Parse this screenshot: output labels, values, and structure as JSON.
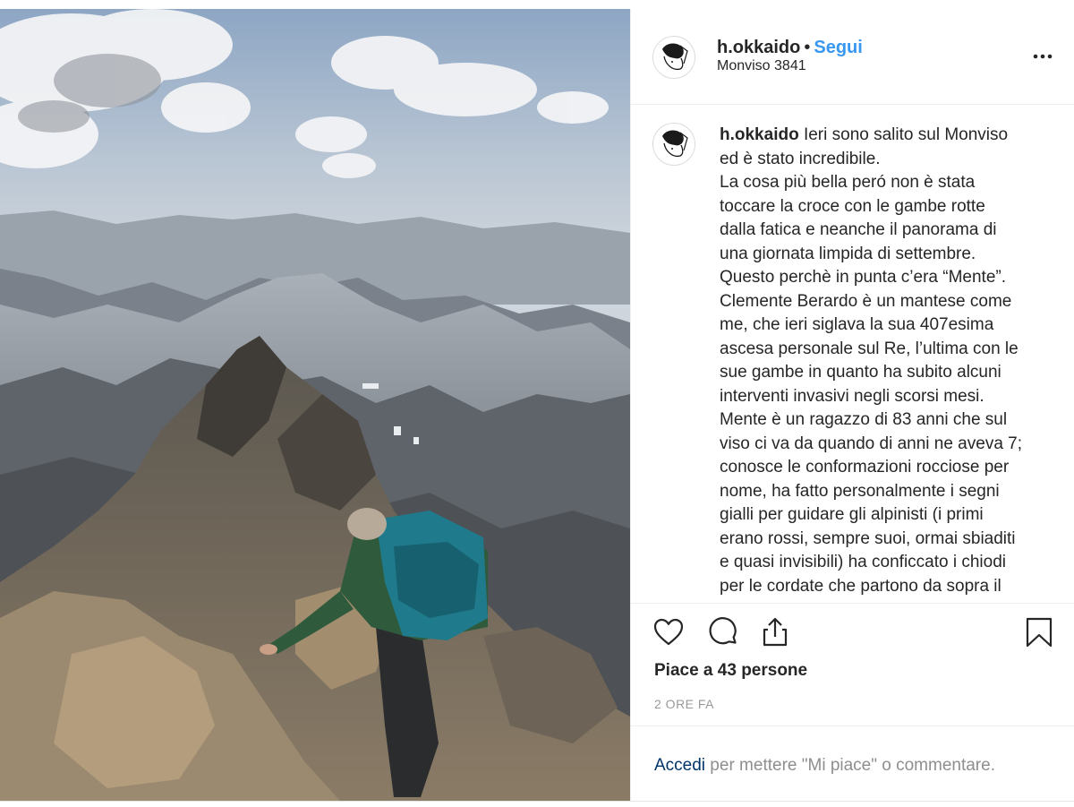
{
  "post": {
    "username": "h.okkaido",
    "separator": "•",
    "follow_label": "Segui",
    "location": "Monviso 3841"
  },
  "caption": {
    "username": "h.okkaido",
    "text": " Ieri sono salito sul Monviso\ned è stato incredibile.\nLa cosa più bella peró non è stata\ntoccare la croce con le gambe rotte\ndalla fatica e neanche il panorama di\nuna giornata limpida di settembre.\nQuesto perchè in punta c’era “Mente”.\nClemente Berardo è un mantese come\nme, che ieri siglava la sua 407esima\nascesa personale sul Re, l’ultima con le\nsue gambe in quanto ha subito alcuni\ninterventi invasivi negli scorsi mesi.\nMente è un ragazzo di 83 anni che sul\nviso ci va da quando di anni ne aveva 7;\nconosce le conformazioni rocciose per\nnome, ha fatto personalmente i segni\ngialli per guidare gli alpinisti (i primi\nerano rossi, sempre suoi, ormai sbiaditi\ne quasi invisibili) ha conficcato i chiodi\nper le cordate che partono da sopra il"
  },
  "actions": {
    "like_icon": "heart-icon",
    "comment_icon": "comment-icon",
    "share_icon": "share-icon",
    "save_icon": "bookmark-icon"
  },
  "likes_label": "Piace a 43 persone",
  "timestamp": "2 ORE FA",
  "login": {
    "link": "Accedi",
    "rest": " per mettere \"Mi piace\" o commentare."
  },
  "colors": {
    "follow": "#3897f0",
    "link": "#003569",
    "muted": "#8e8e8e"
  }
}
